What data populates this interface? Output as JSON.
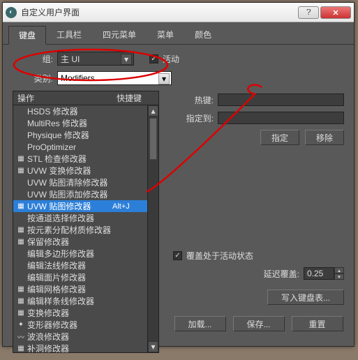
{
  "window": {
    "title": "自定义用户界面"
  },
  "tabs": [
    "键盘",
    "工具栏",
    "四元菜单",
    "菜单",
    "颜色"
  ],
  "group": {
    "label": "组:",
    "value": "主 UI",
    "active_label": "活动"
  },
  "category": {
    "label": "类别:",
    "value": "Modifiers"
  },
  "list": {
    "col_action": "操作",
    "col_shortcut": "快捷键",
    "items": [
      {
        "text": "HSDS 修改器",
        "icon": ""
      },
      {
        "text": "MultiRes 修改器",
        "icon": ""
      },
      {
        "text": "Physique 修改器",
        "icon": ""
      },
      {
        "text": "ProOptimizer",
        "icon": ""
      },
      {
        "text": "STL 检查修改器",
        "icon": "grid"
      },
      {
        "text": "UVW 变换修改器",
        "icon": "grid"
      },
      {
        "text": "UVW 贴图清除修改器",
        "icon": ""
      },
      {
        "text": "UVW 贴图添加修改器",
        "icon": ""
      },
      {
        "text": "UVW 贴图修改器",
        "icon": "grid",
        "shortcut": "Alt+J",
        "selected": true
      },
      {
        "text": "按通道选择修改器",
        "icon": ""
      },
      {
        "text": "按元素分配材质修改器",
        "icon": "grid"
      },
      {
        "text": "保留修改器",
        "icon": "grid"
      },
      {
        "text": "编辑多边形修改器",
        "icon": ""
      },
      {
        "text": "编辑法线修改器",
        "icon": ""
      },
      {
        "text": "编辑面片修改器",
        "icon": ""
      },
      {
        "text": "编辑网格修改器",
        "icon": "grid"
      },
      {
        "text": "编辑样条线修改器",
        "icon": "grid"
      },
      {
        "text": "变换修改器",
        "icon": "grid"
      },
      {
        "text": "变形器修改器",
        "icon": "warp"
      },
      {
        "text": "波浪修改器",
        "icon": "wave"
      },
      {
        "text": "补洞修改器",
        "icon": "grid"
      }
    ]
  },
  "right": {
    "hotkey_label": "热键:",
    "assigned_label": "指定到:",
    "assign_btn": "指定",
    "remove_btn": "移除",
    "override_label": "覆盖处于活动状态",
    "delay_label": "延迟覆盖:",
    "delay_value": "0.25",
    "write_btn": "写入键盘表..."
  },
  "bottom": {
    "load": "加载...",
    "save": "保存...",
    "reset": "重置"
  }
}
